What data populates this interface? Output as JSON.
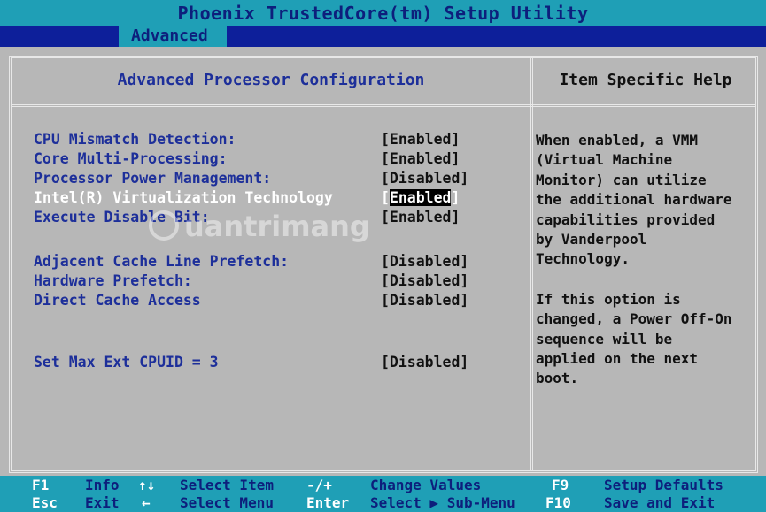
{
  "window": {
    "title": "Phoenix TrustedCore(tm) Setup Utility"
  },
  "menu": {
    "active_tab": "Advanced"
  },
  "panel": {
    "title": "Advanced Processor Configuration",
    "help_title": "Item Specific Help"
  },
  "settings": [
    {
      "label": "CPU Mismatch Detection:",
      "value": "[Enabled]"
    },
    {
      "label": "Core Multi-Processing:",
      "value": "[Enabled]"
    },
    {
      "label": "Processor Power Management:",
      "value": "[Disabled]"
    },
    {
      "label": "Intel(R) Virtualization Technology",
      "value_open": "[",
      "value": "Enabled",
      "value_close": "]",
      "selected": true
    },
    {
      "label": "Execute Disable Bit:",
      "value": "[Enabled]"
    },
    {
      "label": "Adjacent Cache Line Prefetch:",
      "value": "[Disabled]"
    },
    {
      "label": "Hardware Prefetch:",
      "value": "[Disabled]"
    },
    {
      "label": "Direct Cache Access",
      "value": "[Disabled]"
    },
    {
      "label": "Set Max Ext CPUID = 3",
      "value": "[Disabled]"
    }
  ],
  "help": {
    "lines1": [
      "When enabled, a VMM",
      "(Virtual Machine",
      "Monitor) can utilize",
      "the additional hardware",
      "capabilities provided",
      "by Vanderpool",
      "Technology."
    ],
    "lines2": [
      "If this option is",
      "changed, a Power Off-On",
      "sequence will be",
      "applied on the next",
      "boot."
    ]
  },
  "watermark": {
    "text": "uantrimang"
  },
  "footer": {
    "row1": {
      "k1": "F1",
      "d1": "Info",
      "k2": "↑↓",
      "d2": "Select Item",
      "k3": "-/+",
      "d3": "Change Values",
      "k4": "F9",
      "d4": "Setup Defaults"
    },
    "row2": {
      "k1": "Esc",
      "d1": "Exit",
      "k2": "←",
      "d2": "Select Menu",
      "k3": "Enter",
      "d3": "Select ▶ Sub-Menu",
      "k4": "F10",
      "d4": "Save and Exit"
    }
  },
  "colors": {
    "background": "#b7b7b7",
    "title_bar": "#1f9fb6",
    "menu_bar": "#0d1f9a",
    "label_blue": "#1d2f9a",
    "selected_text": "#ffffff"
  }
}
